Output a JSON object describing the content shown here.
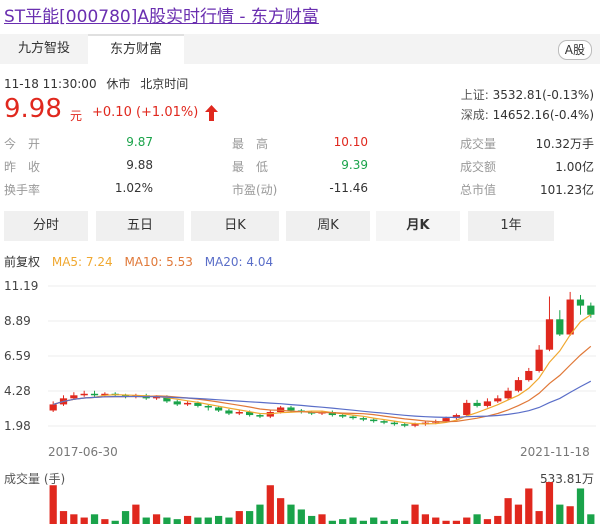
{
  "page": {
    "title": "ST平能[000780]A股实时行情 - 东方财富"
  },
  "tabs": [
    {
      "label": "九方智投"
    },
    {
      "label": "东方财富"
    }
  ],
  "badge": "A股",
  "quote": {
    "time": "11-18 11:30:00",
    "status": "休市",
    "tz": "北京时间",
    "price": "9.98",
    "unit": "元",
    "change": "+0.10 (+1.01%)"
  },
  "indices": [
    {
      "label": "上证:",
      "value": "3532.81(-0.13%)"
    },
    {
      "label": "深成:",
      "value": "14652.16(-0.4%)"
    }
  ],
  "stats": {
    "open_label": "今　开",
    "open": "9.87",
    "prev_label": "昨　收",
    "prev": "9.88",
    "turn_label": "换手率",
    "turn": "1.02%",
    "high_label": "最　高",
    "high": "10.10",
    "low_label": "最　低",
    "low": "9.39",
    "pe_label": "市盈(动)",
    "pe": "-11.46",
    "vol_label": "成交量",
    "vol": "10.32万手",
    "amt_label": "成交额",
    "amt": "1.00亿",
    "cap_label": "总市值",
    "cap": "101.23亿"
  },
  "periods": [
    "分时",
    "五日",
    "日K",
    "周K",
    "月K",
    "1年"
  ],
  "ma": {
    "adj": "前复权",
    "ma5": "MA5: 7.24",
    "ma10": "MA10: 5.53",
    "ma20": "MA20: 4.04"
  },
  "colors": {
    "up": "#e0281e",
    "down": "#1aa34a",
    "ma5": "#f0a830",
    "ma10": "#e07838",
    "ma20": "#5a6ec8"
  },
  "chart_data": {
    "type": "candlestick",
    "y_ticks": [
      "11.19",
      "8.89",
      "6.59",
      "4.28",
      "1.98"
    ],
    "ylim": [
      1.98,
      11.19
    ],
    "x_labels": [
      "2017-06-30",
      "2021-11-18"
    ],
    "volume_label": "成交量 (手)",
    "volume_max": "533.81万",
    "candles": [
      [
        3.0,
        3.4,
        3.6,
        2.9
      ],
      [
        3.4,
        3.8,
        4.0,
        3.3
      ],
      [
        3.8,
        4.0,
        4.2,
        3.7
      ],
      [
        4.0,
        4.1,
        4.3,
        3.9
      ],
      [
        4.1,
        4.0,
        4.3,
        3.9
      ],
      [
        4.0,
        4.1,
        4.2,
        3.9
      ],
      [
        4.1,
        4.0,
        4.2,
        3.9
      ],
      [
        4.0,
        3.9,
        4.1,
        3.8
      ],
      [
        3.9,
        4.0,
        4.1,
        3.8
      ],
      [
        4.0,
        3.8,
        4.1,
        3.7
      ],
      [
        3.8,
        3.9,
        4.0,
        3.7
      ],
      [
        3.9,
        3.6,
        4.0,
        3.5
      ],
      [
        3.6,
        3.4,
        3.7,
        3.3
      ],
      [
        3.4,
        3.5,
        3.6,
        3.3
      ],
      [
        3.5,
        3.3,
        3.6,
        3.2
      ],
      [
        3.3,
        3.2,
        3.4,
        3.0
      ],
      [
        3.2,
        3.0,
        3.3,
        2.9
      ],
      [
        3.0,
        2.8,
        3.1,
        2.7
      ],
      [
        2.8,
        2.9,
        3.0,
        2.7
      ],
      [
        2.9,
        2.7,
        3.0,
        2.6
      ],
      [
        2.7,
        2.6,
        2.8,
        2.5
      ],
      [
        2.6,
        2.9,
        3.0,
        2.5
      ],
      [
        2.9,
        3.2,
        3.3,
        2.8
      ],
      [
        3.2,
        3.0,
        3.3,
        2.9
      ],
      [
        3.0,
        2.9,
        3.1,
        2.8
      ],
      [
        2.9,
        2.8,
        3.0,
        2.7
      ],
      [
        2.8,
        2.9,
        3.0,
        2.7
      ],
      [
        2.9,
        2.7,
        3.0,
        2.6
      ],
      [
        2.7,
        2.6,
        2.8,
        2.5
      ],
      [
        2.6,
        2.5,
        2.7,
        2.4
      ],
      [
        2.5,
        2.4,
        2.6,
        2.3
      ],
      [
        2.4,
        2.3,
        2.5,
        2.2
      ],
      [
        2.3,
        2.2,
        2.4,
        2.1
      ],
      [
        2.2,
        2.1,
        2.3,
        2.0
      ],
      [
        2.1,
        2.0,
        2.2,
        1.9
      ],
      [
        2.0,
        2.1,
        2.2,
        1.9
      ],
      [
        2.1,
        2.2,
        2.3,
        2.0
      ],
      [
        2.2,
        2.3,
        2.4,
        2.1
      ],
      [
        2.3,
        2.5,
        2.6,
        2.2
      ],
      [
        2.5,
        2.7,
        2.8,
        2.4
      ],
      [
        2.7,
        3.5,
        3.7,
        2.6
      ],
      [
        3.5,
        3.3,
        3.7,
        3.2
      ],
      [
        3.3,
        3.6,
        3.8,
        3.2
      ],
      [
        3.6,
        3.8,
        4.0,
        3.5
      ],
      [
        3.8,
        4.3,
        4.5,
        3.7
      ],
      [
        4.3,
        5.0,
        5.2,
        4.2
      ],
      [
        5.0,
        5.6,
        5.8,
        4.9
      ],
      [
        5.6,
        7.0,
        7.3,
        5.5
      ],
      [
        7.0,
        9.0,
        10.5,
        6.9
      ],
      [
        9.0,
        8.0,
        9.6,
        7.9
      ],
      [
        8.0,
        10.3,
        10.8,
        7.9
      ],
      [
        10.3,
        9.9,
        10.6,
        9.3
      ],
      [
        9.9,
        9.3,
        10.1,
        9.1
      ]
    ],
    "volumes": [
      120,
      40,
      30,
      20,
      30,
      15,
      10,
      40,
      60,
      20,
      30,
      20,
      15,
      25,
      20,
      20,
      25,
      20,
      40,
      40,
      60,
      120,
      80,
      60,
      45,
      25,
      30,
      10,
      15,
      20,
      10,
      20,
      10,
      15,
      10,
      60,
      30,
      20,
      10,
      10,
      20,
      30,
      15,
      25,
      80,
      60,
      110,
      40,
      130,
      60,
      55,
      110,
      30
    ]
  }
}
